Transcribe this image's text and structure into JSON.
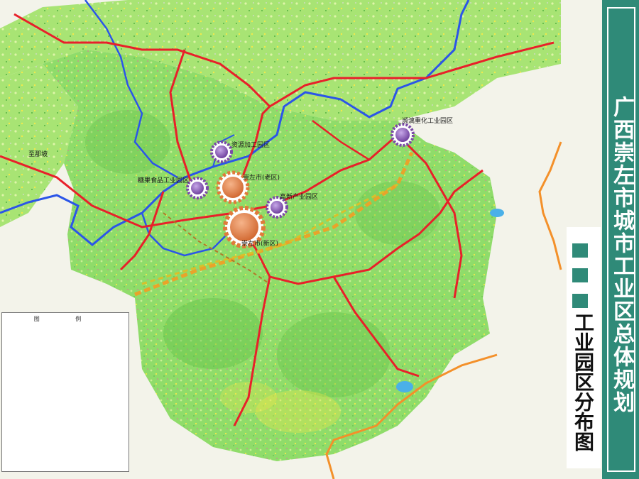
{
  "title": "广西崇左市城市工业区总体规划",
  "subtitle": "工业园区分布图",
  "map_labels": {
    "zone_ziyuan": "资源加工园区",
    "zone_tangguo": "糖果食品工业园区",
    "zone_laoqu": "崇左市(老区)",
    "zone_gaoxin": "高新产业园区",
    "zone_xinqu": "崇左市(新区)",
    "zone_pingxiang": "濒漓重化工业园区",
    "to_napo": "至那坡"
  },
  "legend": {
    "heading": "图 例"
  },
  "colors": {
    "panel": "#2f8a78",
    "forest": "#8fdc6a",
    "forest_dark": "#63c04a",
    "arable": "#c9ee92",
    "road": "#e8202a",
    "river": "#2b55e8",
    "boundary": "#f3902a",
    "corridor": "#e9a32a",
    "zone_major": "#e07a3a",
    "zone_minor": "#7a4aa8"
  }
}
